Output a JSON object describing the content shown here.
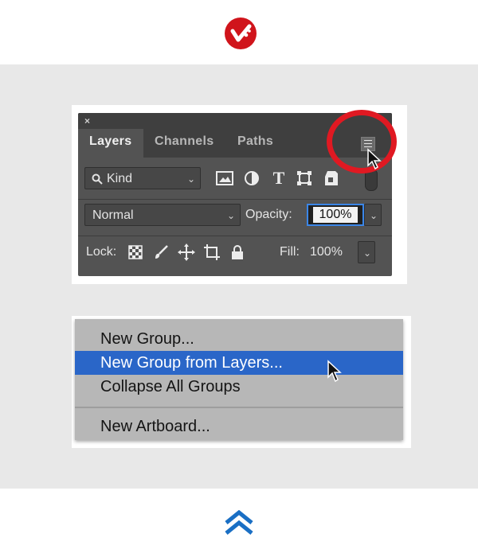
{
  "brand": {
    "logo_icon": "brand-logo-icon",
    "color": "#d0141b"
  },
  "panel": {
    "close_glyph": "×",
    "collapse_glyph": "‹‹",
    "tabs": [
      {
        "label": "Layers",
        "active": true
      },
      {
        "label": "Channels",
        "active": false
      },
      {
        "label": "Paths",
        "active": false
      }
    ],
    "filter": {
      "label": "Kind",
      "icon": "search-icon"
    },
    "filter_icons": [
      "image-icon",
      "adjustment-icon",
      "type-icon",
      "shape-icon",
      "smart-object-icon"
    ],
    "blend_mode": "Normal",
    "opacity_label": "Opacity:",
    "opacity_value": "100%",
    "lock_label": "Lock:",
    "lock_icons": [
      "checkerboard-icon",
      "brush-icon",
      "move-icon",
      "crop-icon",
      "lock-icon"
    ],
    "fill_label": "Fill:",
    "fill_value": "100%",
    "highlight_color": "#e01922"
  },
  "context_menu": {
    "items": [
      {
        "label": "New Group...",
        "selected": false
      },
      {
        "label": "New Group from Layers...",
        "selected": true
      },
      {
        "label": "Collapse All Groups",
        "selected": false
      },
      {
        "label": "New Artboard...",
        "selected": false
      }
    ],
    "selection_color": "#2a66c8"
  },
  "footer": {
    "icon": "double-chevron-up-icon",
    "color": "#1a6fc4"
  }
}
